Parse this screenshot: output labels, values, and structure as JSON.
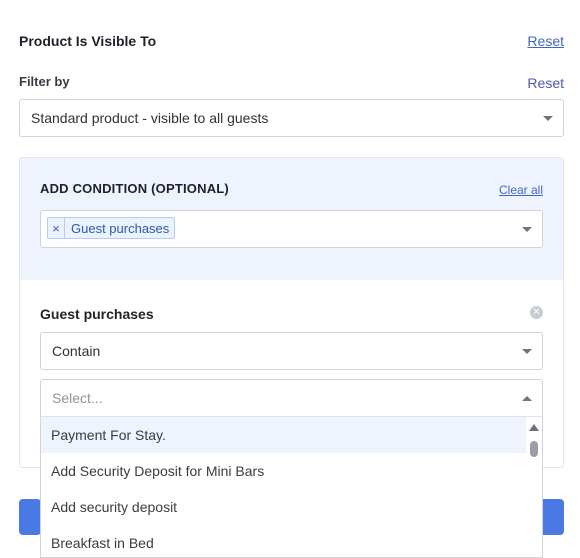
{
  "header": {
    "title": "Product Is Visible To",
    "reset_label": "Reset"
  },
  "filter": {
    "label": "Filter by",
    "reset_label": "Reset",
    "selected": "Standard product - visible to all guests"
  },
  "condition": {
    "label": "ADD CONDITION (OPTIONAL)",
    "clear_all_label": "Clear all",
    "tag_remove": "×",
    "tags": [
      "Guest purchases"
    ]
  },
  "guest_purchases": {
    "label": "Guest purchases",
    "operator": "Contain",
    "select_placeholder": "Select...",
    "options": [
      "Payment For Stay.",
      "Add Security Deposit for Mini Bars",
      "Add security deposit",
      "Breakfast in Bed"
    ]
  },
  "icons": {
    "remove": "x-circle-icon",
    "dropdown": "chevron-down-icon",
    "dropdown_open": "chevron-up-icon",
    "scroll_up": "scroll-up-arrow-icon"
  },
  "colors": {
    "accent": "#4a79e6",
    "link": "#3f66c8",
    "condition_bg": "#eef3fd",
    "tag_bg": "#eaf1ff"
  }
}
